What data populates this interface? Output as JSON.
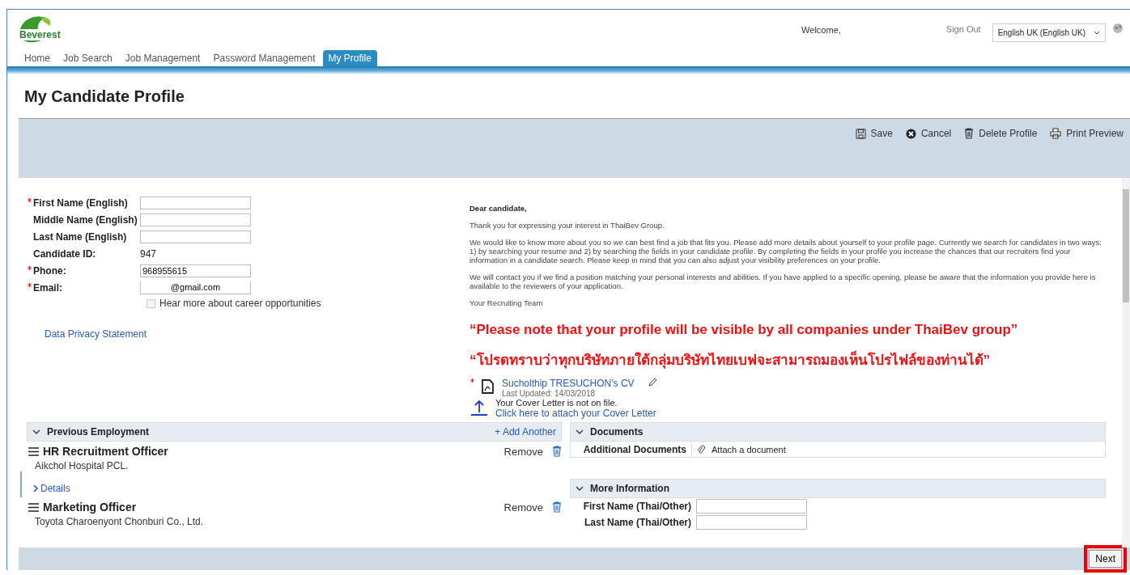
{
  "header": {
    "logo": "Beverest",
    "welcome": "Welcome,",
    "sign_out": "Sign Out",
    "language": "English UK (English UK)"
  },
  "nav": [
    {
      "label": "Home",
      "selected": false
    },
    {
      "label": "Job Search",
      "selected": false
    },
    {
      "label": "Job Management",
      "selected": false
    },
    {
      "label": "Password Management",
      "selected": false
    },
    {
      "label": "My Profile",
      "selected": true
    }
  ],
  "title": "My Candidate Profile",
  "toolbar": [
    {
      "kind": "save",
      "label": "Save"
    },
    {
      "kind": "cancel",
      "label": "Cancel"
    },
    {
      "kind": "delete",
      "label": "Delete Profile"
    },
    {
      "kind": "print",
      "label": "Print Preview"
    }
  ],
  "fields": [
    {
      "kind": "input",
      "label": "First Name (English)",
      "required": true
    },
    {
      "kind": "input",
      "label": "Middle Name (English)",
      "required": false
    },
    {
      "kind": "input",
      "label": "Last Name (English)",
      "required": false
    },
    {
      "kind": "text",
      "label": "Candidate ID:",
      "required": false,
      "value": "947"
    },
    {
      "kind": "input",
      "label": "Phone:",
      "required": true,
      "value": "968955615"
    },
    {
      "kind": "email",
      "label": "Email:",
      "required": true,
      "value": "@gmail.com"
    }
  ],
  "opt_in": {
    "label": "Hear more about career opportunities",
    "checked": false
  },
  "privacy_link": "Data Privacy Statement",
  "letter": {
    "greeting": "Dear candidate,",
    "paragraphs": [
      "Thank you for expressing your interest in ThaiBev Group.",
      "We would like to know more about you so we can best find a job that fits you. Please add more details about yourself to your profile page. Currently we search for candidates in two ways: 1) by searching your resume and 2) by searching the fields in your candidate profile. By completing the fields in your profile you increase the chances that our recruiters find your information in a candidate search. Please keep in mind that you can also adjust your visibility preferences on your profile.",
      "We will contact you if we find a position matching your personal interests and abilities. If you have applied to a specific opening, please be aware that the information you provide here is available to the reviewers of your application."
    ],
    "signature": "Your Recruiting Team"
  },
  "notices": [
    "“Please note that your profile will be visible by all companies under ThaiBev group”",
    "“โปรดทราบว่าทุกบริษัทภายใต้กลุ่มบริษัทไทยเบฟจะสามารถมองเห็นโปรไฟล์ของท่านได้”"
  ],
  "resume": {
    "required": true,
    "name": "Sucholthip TRESUCHON’s CV",
    "updated": "Last Updated: 14/03/2018"
  },
  "cover_letter": {
    "status": "Your Cover Letter is not on file.",
    "link": "Click here to attach your Cover Letter"
  },
  "employment": {
    "title": "Previous Employment",
    "expanded": true,
    "add": "+ Add Another",
    "items": [
      {
        "title": "HR Recruitment Officer",
        "company": "Aikchol Hospital PCL.",
        "remove": "Remove",
        "details": "Details"
      },
      {
        "title": "Marketing Officer",
        "company": "Toyota Charoenyont Chonburi Co., Ltd.",
        "remove": "Remove"
      }
    ]
  },
  "documents": {
    "title": "Documents",
    "expanded": true,
    "rows": [
      {
        "label": "Additional Documents",
        "action": "Attach a document"
      }
    ]
  },
  "more_info": {
    "title": "More Information",
    "expanded": true,
    "fields": [
      "First Name (Thai/Other)",
      "Last Name (Thai/Other)"
    ]
  },
  "next": {
    "label": "Next",
    "highlighted": true
  }
}
